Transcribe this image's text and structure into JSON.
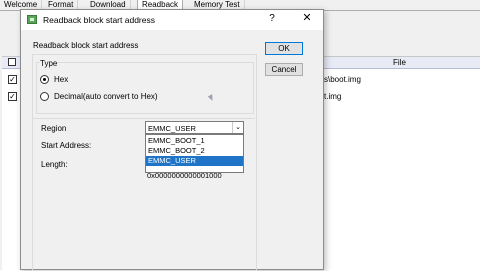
{
  "tabs": [
    "Welcome",
    "Format",
    "Download",
    "Readback",
    "Memory Test"
  ],
  "active_tab_index": 3,
  "background": {
    "file_header": "File",
    "rows": [
      {
        "checked": true,
        "path_fragment": "s\\boot.img"
      },
      {
        "checked": true,
        "path_fragment": "t.img"
      }
    ]
  },
  "dialog": {
    "title": "Readback block start address",
    "help_glyph": "?",
    "close_glyph": "✕",
    "subtitle": "Readback block start address",
    "type_group_label": "Type",
    "radios": [
      {
        "label": "Hex",
        "selected": true
      },
      {
        "label": "Decimal(auto convert to Hex)",
        "selected": false
      }
    ],
    "region_label": "Region",
    "region_value": "EMMC_USER",
    "region_options": [
      "EMMC_BOOT_1",
      "EMMC_BOOT_2",
      "EMMC_USER"
    ],
    "region_selected_index": 2,
    "start_address_label": "Start Address:",
    "length_label": "Length:",
    "length_value": "0x0000000000001000",
    "ok_label": "OK",
    "cancel_label": "Cancel"
  },
  "colors": {
    "selection_blue": "#1f74c7",
    "default_button_border": "#0078d7",
    "dialog_bg": "#f0f0f0"
  }
}
